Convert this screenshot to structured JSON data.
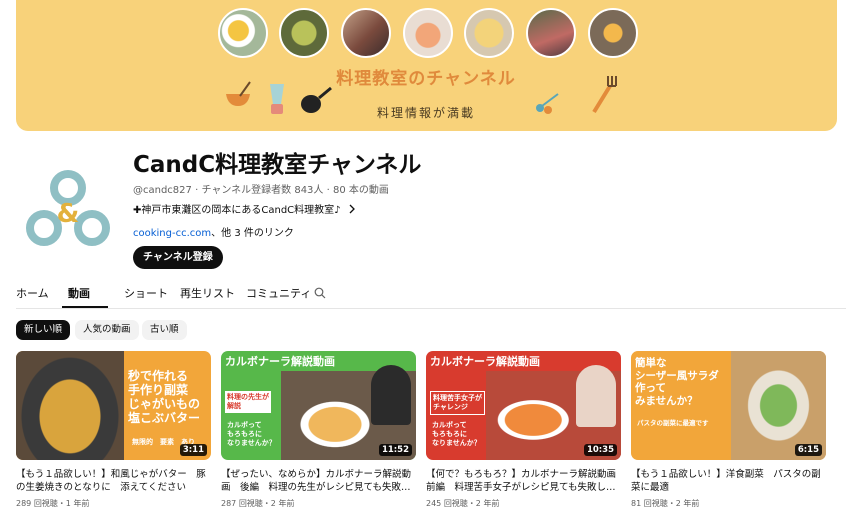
{
  "banner": {
    "title": "料理教室のチャンネル",
    "subtitle": "料理情報が満載"
  },
  "channel": {
    "name": "CandC料理教室チャンネル",
    "handle": "@candc827",
    "subscribers": "チャンネル登録者数 843人",
    "video_count": "80 本の動画",
    "description": "✚神戸市東灘区の岡本にあるCandC料理教室♪",
    "link": "cooking-cc.com",
    "more_links": "、他 3 件のリンク",
    "subscribe_label": "チャンネル登録",
    "logo_text": "&"
  },
  "tabs": [
    "ホーム",
    "動画",
    "ショート",
    "再生リスト",
    "コミュニティ"
  ],
  "chips": [
    "新しい順",
    "人気の動画",
    "古い順"
  ],
  "videos": [
    {
      "title": "【もう１品欲しい！】和風じゃがバター　豚の生姜焼きのとなりに　添えてください",
      "meta": "289 回視聴・1 年前",
      "duration": "3:11",
      "thumb_lines": [
        "秒で作れる",
        "手作り副菜",
        "じゃがいもの",
        "塩こぶバター"
      ],
      "thumb_footer": "無限的　要素　あり"
    },
    {
      "title": "【ぜったい、なめらか】カルボナーラ解説動画　後編　料理の先生がレシピ見ても失敗…",
      "meta": "287 回視聴・2 年前",
      "duration": "11:52",
      "thumb_header": "カルボナーラ解説動画",
      "thumb_tag": [
        "料理の先生が",
        "解説"
      ],
      "thumb_note": [
        "カルボって",
        "もろもろに",
        "なりませんか？"
      ]
    },
    {
      "title": "【何で？もろもろ？】カルボナーラ解説動画　前編　料理苦手女子がレシピ見ても失敗し…",
      "meta": "245 回視聴・2 年前",
      "duration": "10:35",
      "thumb_header": "カルボナーラ解説動画",
      "thumb_tag": [
        "料理苦手女子が",
        "チャレンジ"
      ],
      "thumb_note": [
        "カルボって",
        "もろもろに",
        "なりませんか？"
      ]
    },
    {
      "title": "【もう１品欲しい！】洋食副菜　パスタの副菜に最適",
      "meta": "81 回視聴・2 年前",
      "duration": "6:15",
      "thumb_lines": [
        "簡単な",
        "シーザー風サラダ",
        "作って",
        "みませんか？"
      ],
      "thumb_footer": "パスタの副菜に最適です"
    }
  ],
  "colors": {
    "banner_bg": "#f8d27a",
    "logo_teal": "#8fbfc4",
    "logo_gold": "#e3b13c",
    "thumb_orange": "#f2a63a",
    "thumb_green": "#57b84a",
    "thumb_red": "#d83b2e"
  },
  "icons": {
    "search_tab": "search-icon",
    "description_more": "chevron-right-icon"
  }
}
